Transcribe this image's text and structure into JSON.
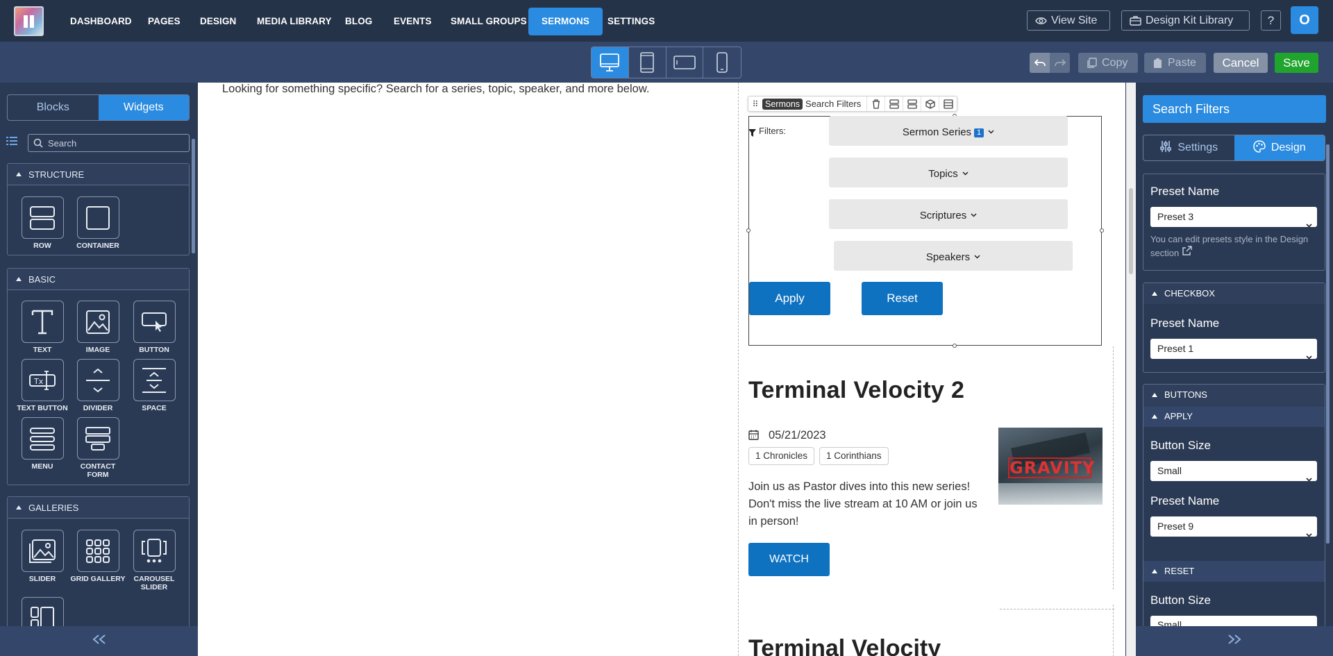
{
  "nav": {
    "items": [
      "DASHBOARD",
      "PAGES",
      "DESIGN",
      "MEDIA LIBRARY",
      "BLOG",
      "EVENTS",
      "SMALL GROUPS",
      "SERMONS",
      "SETTINGS"
    ],
    "active": "SERMONS",
    "view_site": "View Site",
    "design_kit": "Design Kit Library",
    "help": "?",
    "avatar": "O"
  },
  "toolbar": {
    "copy": "Copy",
    "paste": "Paste",
    "cancel": "Cancel",
    "save": "Save",
    "devices": [
      "desktop-icon",
      "tablet-icon",
      "tablet-landscape-icon",
      "phone-icon"
    ],
    "active_device": "desktop"
  },
  "left": {
    "tabs": [
      "Blocks",
      "Widgets"
    ],
    "active_tab": "Widgets",
    "search_placeholder": "Search",
    "sections": [
      {
        "title": "STRUCTURE",
        "widgets": [
          "ROW",
          "CONTAINER"
        ]
      },
      {
        "title": "BASIC",
        "widgets": [
          "TEXT",
          "IMAGE",
          "BUTTON",
          "TEXT BUTTON",
          "DIVIDER",
          "SPACE",
          "MENU",
          "CONTACT FORM"
        ]
      },
      {
        "title": "GALLERIES",
        "widgets": [
          "SLIDER",
          "GRID GALLERY",
          "CAROUSEL SLIDER"
        ]
      }
    ]
  },
  "canvas": {
    "intro": "Looking for something specific? Search for a series, topic, speaker, and more below.",
    "widget_toolbar": {
      "tag": "Sermons",
      "label": "Search Filters"
    },
    "filters_label": "Filters:",
    "filters": [
      {
        "label": "Sermon Series",
        "badge": "1"
      },
      {
        "label": "Topics"
      },
      {
        "label": "Scriptures"
      },
      {
        "label": "Speakers"
      }
    ],
    "apply": "Apply",
    "reset": "Reset",
    "sermon": {
      "title": "Terminal Velocity 2",
      "date": "05/21/2023",
      "tags": [
        "1 Chronicles",
        "1 Corinthians"
      ],
      "description": "Join us as Pastor dives into this new series! Don't miss the live stream at 10 AM or join us in person!",
      "watch": "WATCH",
      "thumb_text": "GRAVITY"
    },
    "next_title": "Terminal Velocity"
  },
  "right": {
    "title": "Search Filters",
    "tabs": [
      "Settings",
      "Design"
    ],
    "active_tab": "Design",
    "preset_label": "Preset Name",
    "preset_value": "Preset 3",
    "note": "You can edit presets style in the Design section",
    "checkbox": {
      "title": "CHECKBOX",
      "label": "Preset Name",
      "value": "Preset 1"
    },
    "buttons": {
      "title": "BUTTONS",
      "apply": {
        "title": "APPLY",
        "size_label": "Button Size",
        "size_value": "Small",
        "preset_label": "Preset Name",
        "preset_value": "Preset 9"
      },
      "reset": {
        "title": "RESET",
        "size_label": "Button Size",
        "size_value": "Small"
      }
    }
  },
  "colors": {
    "accent": "#2a8be0",
    "save": "#1fa42d",
    "nav_bg": "#253349",
    "panel_bg": "#2b3a54",
    "button_blue": "#0f72c0"
  }
}
